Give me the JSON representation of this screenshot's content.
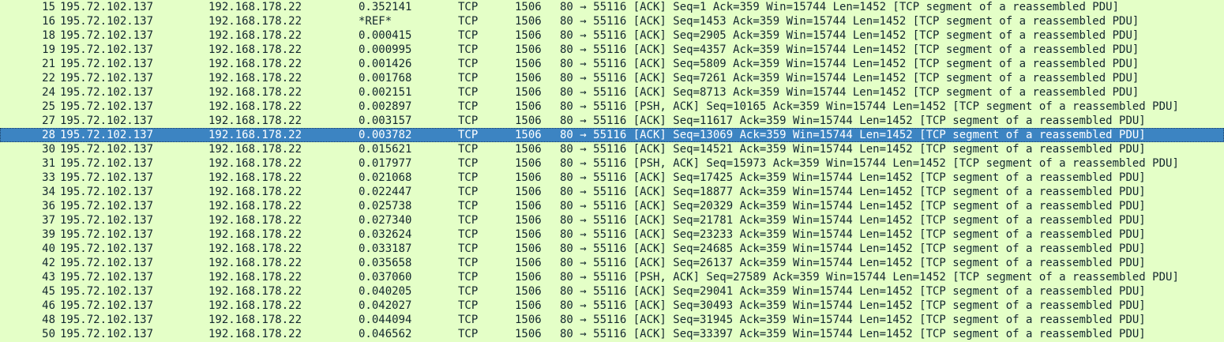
{
  "packet_list": {
    "selected_no": "28",
    "rows": [
      {
        "no": "15",
        "source": "195.72.102.137",
        "destination": "192.168.178.22",
        "time": "0.352141",
        "protocol": "TCP",
        "length": "1506",
        "info": "80 → 55116 [ACK] Seq=1 Ack=359 Win=15744 Len=1452 [TCP segment of a reassembled PDU]"
      },
      {
        "no": "16",
        "source": "195.72.102.137",
        "destination": "192.168.178.22",
        "time": "*REF*",
        "protocol": "TCP",
        "length": "1506",
        "info": "80 → 55116 [ACK] Seq=1453 Ack=359 Win=15744 Len=1452 [TCP segment of a reassembled PDU]"
      },
      {
        "no": "18",
        "source": "195.72.102.137",
        "destination": "192.168.178.22",
        "time": "0.000415",
        "protocol": "TCP",
        "length": "1506",
        "info": "80 → 55116 [ACK] Seq=2905 Ack=359 Win=15744 Len=1452 [TCP segment of a reassembled PDU]"
      },
      {
        "no": "19",
        "source": "195.72.102.137",
        "destination": "192.168.178.22",
        "time": "0.000995",
        "protocol": "TCP",
        "length": "1506",
        "info": "80 → 55116 [ACK] Seq=4357 Ack=359 Win=15744 Len=1452 [TCP segment of a reassembled PDU]"
      },
      {
        "no": "21",
        "source": "195.72.102.137",
        "destination": "192.168.178.22",
        "time": "0.001426",
        "protocol": "TCP",
        "length": "1506",
        "info": "80 → 55116 [ACK] Seq=5809 Ack=359 Win=15744 Len=1452 [TCP segment of a reassembled PDU]"
      },
      {
        "no": "22",
        "source": "195.72.102.137",
        "destination": "192.168.178.22",
        "time": "0.001768",
        "protocol": "TCP",
        "length": "1506",
        "info": "80 → 55116 [ACK] Seq=7261 Ack=359 Win=15744 Len=1452 [TCP segment of a reassembled PDU]"
      },
      {
        "no": "24",
        "source": "195.72.102.137",
        "destination": "192.168.178.22",
        "time": "0.002151",
        "protocol": "TCP",
        "length": "1506",
        "info": "80 → 55116 [ACK] Seq=8713 Ack=359 Win=15744 Len=1452 [TCP segment of a reassembled PDU]"
      },
      {
        "no": "25",
        "source": "195.72.102.137",
        "destination": "192.168.178.22",
        "time": "0.002897",
        "protocol": "TCP",
        "length": "1506",
        "info": "80 → 55116 [PSH, ACK] Seq=10165 Ack=359 Win=15744 Len=1452 [TCP segment of a reassembled PDU]"
      },
      {
        "no": "27",
        "source": "195.72.102.137",
        "destination": "192.168.178.22",
        "time": "0.003157",
        "protocol": "TCP",
        "length": "1506",
        "info": "80 → 55116 [ACK] Seq=11617 Ack=359 Win=15744 Len=1452 [TCP segment of a reassembled PDU]"
      },
      {
        "no": "28",
        "source": "195.72.102.137",
        "destination": "192.168.178.22",
        "time": "0.003782",
        "protocol": "TCP",
        "length": "1506",
        "info": "80 → 55116 [ACK] Seq=13069 Ack=359 Win=15744 Len=1452 [TCP segment of a reassembled PDU]"
      },
      {
        "no": "30",
        "source": "195.72.102.137",
        "destination": "192.168.178.22",
        "time": "0.015621",
        "protocol": "TCP",
        "length": "1506",
        "info": "80 → 55116 [ACK] Seq=14521 Ack=359 Win=15744 Len=1452 [TCP segment of a reassembled PDU]"
      },
      {
        "no": "31",
        "source": "195.72.102.137",
        "destination": "192.168.178.22",
        "time": "0.017977",
        "protocol": "TCP",
        "length": "1506",
        "info": "80 → 55116 [PSH, ACK] Seq=15973 Ack=359 Win=15744 Len=1452 [TCP segment of a reassembled PDU]"
      },
      {
        "no": "33",
        "source": "195.72.102.137",
        "destination": "192.168.178.22",
        "time": "0.021068",
        "protocol": "TCP",
        "length": "1506",
        "info": "80 → 55116 [ACK] Seq=17425 Ack=359 Win=15744 Len=1452 [TCP segment of a reassembled PDU]"
      },
      {
        "no": "34",
        "source": "195.72.102.137",
        "destination": "192.168.178.22",
        "time": "0.022447",
        "protocol": "TCP",
        "length": "1506",
        "info": "80 → 55116 [ACK] Seq=18877 Ack=359 Win=15744 Len=1452 [TCP segment of a reassembled PDU]"
      },
      {
        "no": "36",
        "source": "195.72.102.137",
        "destination": "192.168.178.22",
        "time": "0.025738",
        "protocol": "TCP",
        "length": "1506",
        "info": "80 → 55116 [ACK] Seq=20329 Ack=359 Win=15744 Len=1452 [TCP segment of a reassembled PDU]"
      },
      {
        "no": "37",
        "source": "195.72.102.137",
        "destination": "192.168.178.22",
        "time": "0.027340",
        "protocol": "TCP",
        "length": "1506",
        "info": "80 → 55116 [ACK] Seq=21781 Ack=359 Win=15744 Len=1452 [TCP segment of a reassembled PDU]"
      },
      {
        "no": "39",
        "source": "195.72.102.137",
        "destination": "192.168.178.22",
        "time": "0.032624",
        "protocol": "TCP",
        "length": "1506",
        "info": "80 → 55116 [ACK] Seq=23233 Ack=359 Win=15744 Len=1452 [TCP segment of a reassembled PDU]"
      },
      {
        "no": "40",
        "source": "195.72.102.137",
        "destination": "192.168.178.22",
        "time": "0.033187",
        "protocol": "TCP",
        "length": "1506",
        "info": "80 → 55116 [ACK] Seq=24685 Ack=359 Win=15744 Len=1452 [TCP segment of a reassembled PDU]"
      },
      {
        "no": "42",
        "source": "195.72.102.137",
        "destination": "192.168.178.22",
        "time": "0.035658",
        "protocol": "TCP",
        "length": "1506",
        "info": "80 → 55116 [ACK] Seq=26137 Ack=359 Win=15744 Len=1452 [TCP segment of a reassembled PDU]"
      },
      {
        "no": "43",
        "source": "195.72.102.137",
        "destination": "192.168.178.22",
        "time": "0.037060",
        "protocol": "TCP",
        "length": "1506",
        "info": "80 → 55116 [PSH, ACK] Seq=27589 Ack=359 Win=15744 Len=1452 [TCP segment of a reassembled PDU]"
      },
      {
        "no": "45",
        "source": "195.72.102.137",
        "destination": "192.168.178.22",
        "time": "0.040205",
        "protocol": "TCP",
        "length": "1506",
        "info": "80 → 55116 [ACK] Seq=29041 Ack=359 Win=15744 Len=1452 [TCP segment of a reassembled PDU]"
      },
      {
        "no": "46",
        "source": "195.72.102.137",
        "destination": "192.168.178.22",
        "time": "0.042027",
        "protocol": "TCP",
        "length": "1506",
        "info": "80 → 55116 [ACK] Seq=30493 Ack=359 Win=15744 Len=1452 [TCP segment of a reassembled PDU]"
      },
      {
        "no": "48",
        "source": "195.72.102.137",
        "destination": "192.168.178.22",
        "time": "0.044094",
        "protocol": "TCP",
        "length": "1506",
        "info": "80 → 55116 [ACK] Seq=31945 Ack=359 Win=15744 Len=1452 [TCP segment of a reassembled PDU]"
      },
      {
        "no": "50",
        "source": "195.72.102.137",
        "destination": "192.168.178.22",
        "time": "0.046562",
        "protocol": "TCP",
        "length": "1506",
        "info": "80 → 55116 [ACK] Seq=33397 Ack=359 Win=15744 Len=1452 [TCP segment of a reassembled PDU]"
      }
    ]
  },
  "colors": {
    "row_background": "#e4ffc7",
    "row_text": "#12272e",
    "selected_background": "#3c84c2",
    "selected_text": "#ffffff"
  }
}
